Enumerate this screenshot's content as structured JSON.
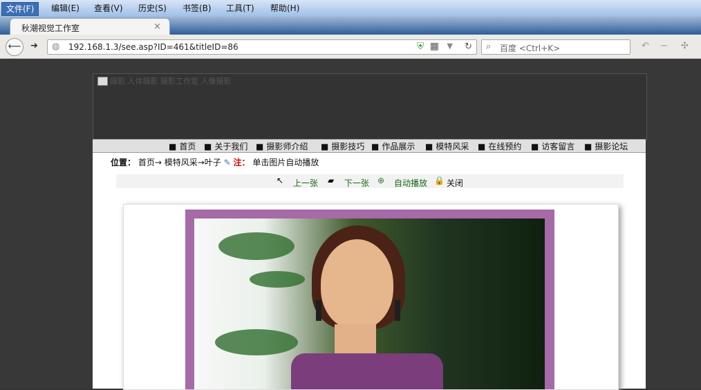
{
  "menus": [
    "文件(F)",
    "编辑(E)",
    "查看(V)",
    "历史(S)",
    "书签(B)",
    "工具(T)",
    "帮助(H)"
  ],
  "tab": {
    "title": "秋潮视觉工作室",
    "close": "×",
    "new": "+"
  },
  "nav": {
    "back": "⟵",
    "forward": "➜",
    "url": "192.168.1.3/see.asp?ID=461&titleID=86",
    "search": "百度 <Ctrl+K>"
  },
  "site": {
    "banner_title": "摄影 人体摄影 摄影工作室 人像摄影",
    "nav_links": [
      "首页",
      "关于我们",
      "摄影师介绍",
      "摄影技巧",
      "作品展示",
      "模特风采",
      "在线预约",
      "访客留言",
      "摄影论坛"
    ],
    "location_label": "位置：",
    "location_path": "首页→ 模特风采→叶子",
    "note_label": "注：",
    "note_text": "单击图片自动播放",
    "controls": {
      "prev": "上一张",
      "next": "下一张",
      "auto": "自动播放",
      "close": "关闭"
    }
  }
}
